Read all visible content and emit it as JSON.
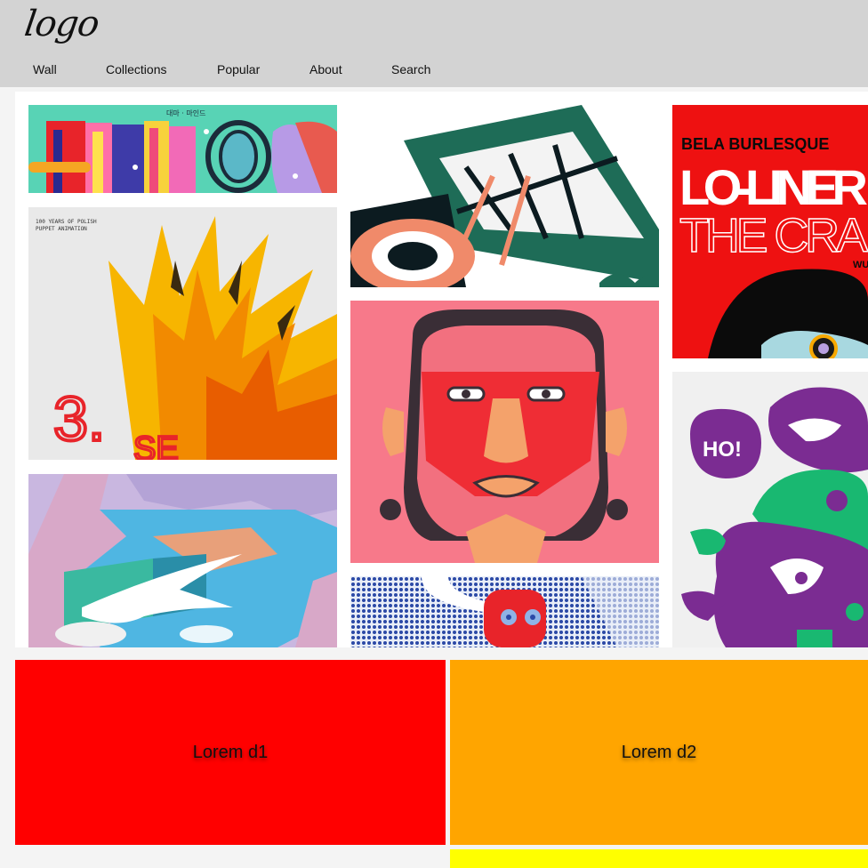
{
  "header": {
    "logo_text": "logo",
    "nav": [
      {
        "label": "Wall"
      },
      {
        "label": "Collections"
      },
      {
        "label": "Popular"
      },
      {
        "label": "About"
      },
      {
        "label": "Search"
      }
    ]
  },
  "gallery": {
    "cards": [
      {
        "subject": "colorful lettering poster"
      },
      {
        "subject": "green aircraft illustration"
      },
      {
        "subject": "Lo-Liner poster"
      },
      {
        "subject": "yellow wings puppet animation poster"
      },
      {
        "subject": "red face portrait"
      },
      {
        "subject": "purple skull graffiti"
      },
      {
        "subject": "river landscape with white bird"
      },
      {
        "subject": "blue halftone character"
      }
    ],
    "texts": {
      "lettering_small": "대마 · 마인드",
      "puppet_caption_line1": "100 YEARS OF POLISH",
      "puppet_caption_line2": "PUPPET ANIMATION",
      "puppet_number": "3.",
      "puppet_letters": "SE",
      "lo_liner_line1": "BELA BURLESQUE",
      "lo_liner_line2": "LO-LINER",
      "lo_liner_line3": "THE CRA",
      "lo_liner_line4": "WU",
      "graffiti_bubble": "HO!"
    }
  },
  "tiles": [
    {
      "label": "Lorem d1",
      "color": "#ff0000"
    },
    {
      "label": "Lorem d2",
      "color": "#ffa500"
    },
    {
      "label": "",
      "color": "#ffff00"
    }
  ],
  "colors": {
    "header_bg": "#d3d3d3",
    "page_bg": "#f4f4f4"
  }
}
